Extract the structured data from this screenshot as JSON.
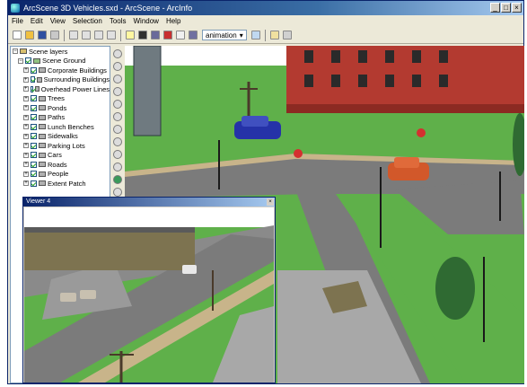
{
  "window": {
    "title": "ArcScene 3D Vehicles.sxd - ArcScene - ArcInfo"
  },
  "menu": [
    "File",
    "Edit",
    "View",
    "Selection",
    "Tools",
    "Window",
    "Help"
  ],
  "toolbar": {
    "dropdown_value": "animation"
  },
  "toc": {
    "title": "Scene layers",
    "group": "Scene Ground",
    "layers": [
      "Corporate Buildings",
      "Surrounding Buildings",
      "Overhead Power Lines",
      "Trees",
      "Ponds",
      "Paths",
      "Lunch Benches",
      "Sidewalks",
      "Parking Lots",
      "Cars",
      "Roads",
      "People",
      "Extent Patch"
    ]
  },
  "viewer2": {
    "title": "Viewer 4"
  },
  "colors": {
    "title_bar": "#0a246a",
    "grass": "#5fb04a",
    "road": "#7b7b7b",
    "building_red": "#b33a30",
    "car_blue": "#2532a8",
    "car_orange": "#d2582a"
  }
}
